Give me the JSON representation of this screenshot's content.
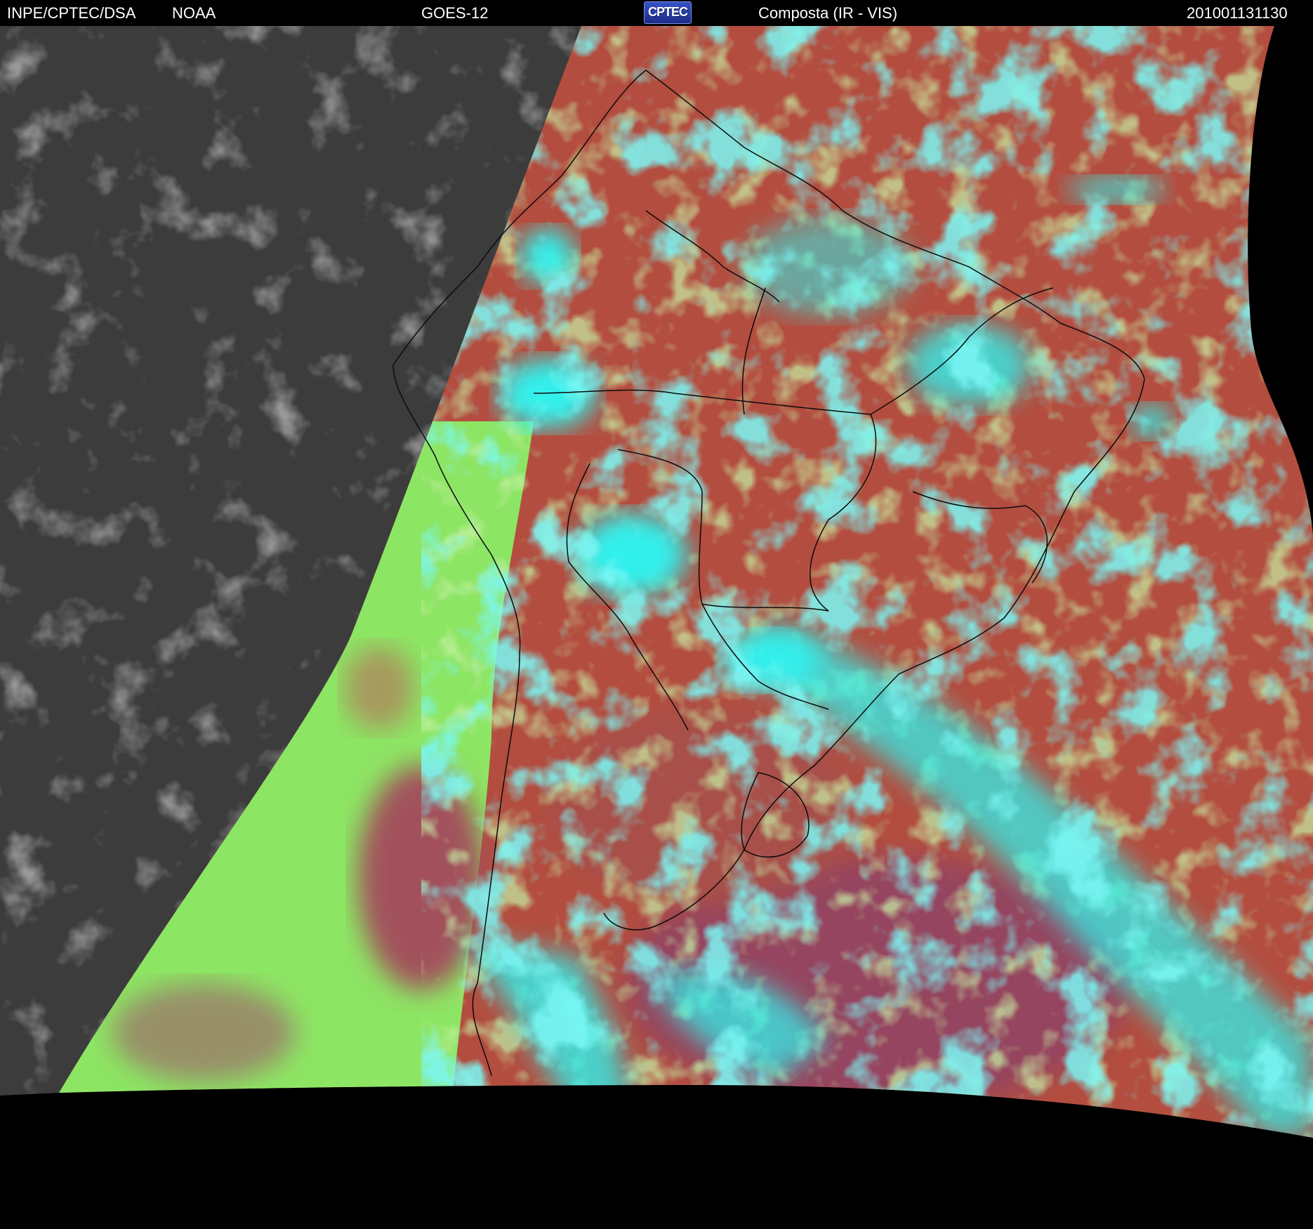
{
  "header": {
    "agency": "INPE/CPTEC/DSA",
    "source": "NOAA",
    "satellite": "GOES-12",
    "logo": "CPTEC",
    "product": "Composta (IR - VIS)",
    "timestamp": "201001131130"
  },
  "colors": {
    "background": "#000000",
    "ir_gray": "#3c3c3c",
    "ocean_green": "#8de564",
    "land_red": "#b34d3f",
    "cloud_cyan": "#33f0ec",
    "ocean_magenta": "#95445f",
    "coastline": "#0b0b0b"
  }
}
